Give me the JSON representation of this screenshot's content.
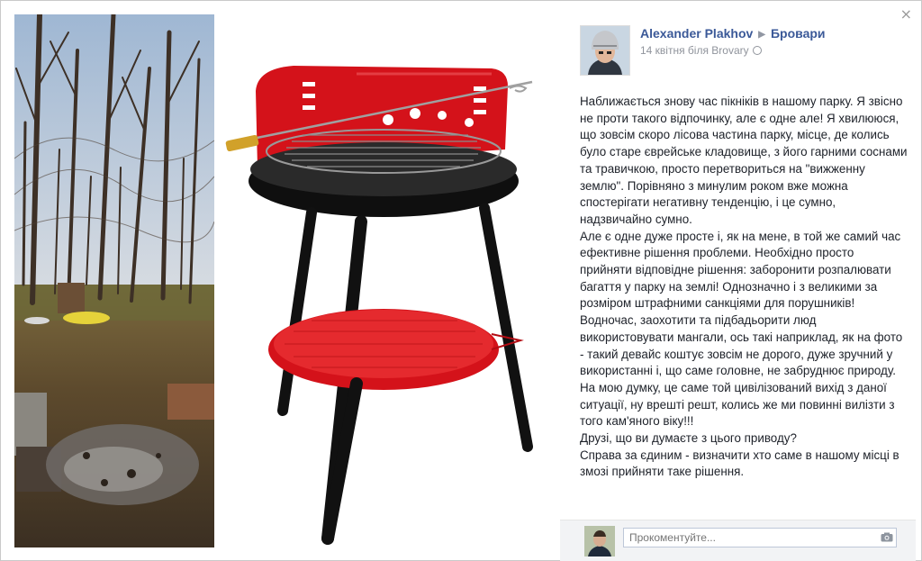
{
  "post": {
    "author": "Alexander Plakhov",
    "location": "Бровари",
    "date": "14 квітня біля Brovary",
    "paragraphs": [
      "Наближається знову час пікніків в нашому парку. Я звісно не проти такого відпочинку, але є одне але! Я хвилююся, що зовсім скоро лісова частина парку, місце, де колись було старе єврейське кладовище, з його гарними соснами та травичкою, просто перетвориться на \"вижженну землю\". Порівняно з минулим роком вже можна спостерігати негативну тенденцію, і це сумно, надзвичайно сумно.",
      "Але є одне дуже просте і, як на мене, в той же самий час ефективне рішення проблеми. Необхідно просто прийняти відповідне рішення: заборонити розпалювати багаття у парку на землі! Однозначно і з великими за розміром штрафними санкціями для порушників! Водночас, заохотити та підбадьорити люд використовувати мангали, ось такі наприклад, як на фото - такий девайс коштує зовсім не дорого, дуже зручний у використанні і, що саме головне, не забруднює природу. На мою думку, це саме той цивілізований вихід з даної ситуації, ну врешті решт, колись же ми повинні вилізти з того кам'яного віку!!!",
      "Друзі, що ви думаєте з цього приводу?",
      "Справа за єдиним - визначити хто саме в нашому місці в змозі прийняти таке рішення."
    ]
  },
  "comment": {
    "placeholder": "Прокоментуйте..."
  },
  "ui": {
    "close_symbol": "×"
  },
  "colors": {
    "link": "#3b5998",
    "meta": "#90949c",
    "grill_red": "#d4121a"
  },
  "icons": {
    "close": "close-icon",
    "globe": "globe-icon",
    "camera": "camera-icon",
    "arrow": "triangle-right-icon"
  }
}
